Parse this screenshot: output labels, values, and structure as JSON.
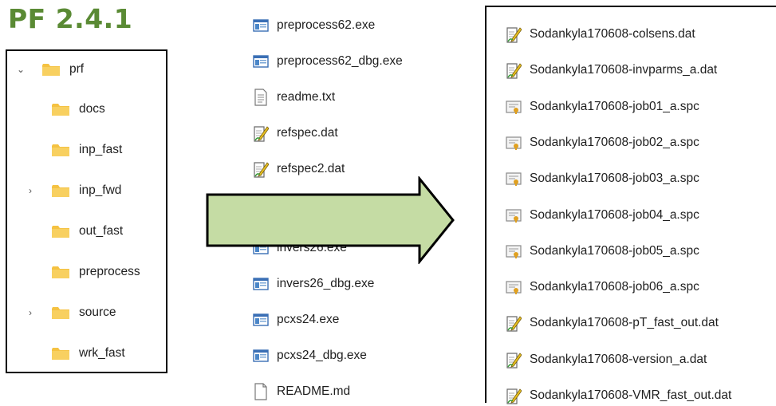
{
  "title": "PF 2.4.1",
  "tree": {
    "root": "prf",
    "items": [
      {
        "label": "docs",
        "expandable": false
      },
      {
        "label": "inp_fast",
        "expandable": false
      },
      {
        "label": "inp_fwd",
        "expandable": true
      },
      {
        "label": "out_fast",
        "expandable": false
      },
      {
        "label": "preprocess",
        "expandable": false
      },
      {
        "label": "source",
        "expandable": true
      },
      {
        "label": "wrk_fast",
        "expandable": false
      }
    ]
  },
  "middle_files": [
    {
      "name": "preprocess62.exe",
      "icon": "exe-icon"
    },
    {
      "name": "preprocess62_dbg.exe",
      "icon": "exe-icon"
    },
    {
      "name": "readme.txt",
      "icon": "text-file-icon"
    },
    {
      "name": "refspec.dat",
      "icon": "dat-file-icon"
    },
    {
      "name": "refspec2.dat",
      "icon": "dat-file-icon"
    },
    {
      "name": "invers26.exe",
      "icon": "exe-icon"
    },
    {
      "name": "invers26_dbg.exe",
      "icon": "exe-icon"
    },
    {
      "name": "pcxs24.exe",
      "icon": "exe-icon"
    },
    {
      "name": "pcxs24_dbg.exe",
      "icon": "exe-icon"
    },
    {
      "name": "README.md",
      "icon": "blank-file-icon"
    }
  ],
  "right_files": [
    {
      "name": "Sodankyla170608-colsens.dat",
      "icon": "dat-file-icon"
    },
    {
      "name": "Sodankyla170608-invparms_a.dat",
      "icon": "dat-file-icon"
    },
    {
      "name": "Sodankyla170608-job01_a.spc",
      "icon": "spc-file-icon"
    },
    {
      "name": "Sodankyla170608-job02_a.spc",
      "icon": "spc-file-icon"
    },
    {
      "name": "Sodankyla170608-job03_a.spc",
      "icon": "spc-file-icon"
    },
    {
      "name": "Sodankyla170608-job04_a.spc",
      "icon": "spc-file-icon"
    },
    {
      "name": "Sodankyla170608-job05_a.spc",
      "icon": "spc-file-icon"
    },
    {
      "name": "Sodankyla170608-job06_a.spc",
      "icon": "spc-file-icon"
    },
    {
      "name": "Sodankyla170608-pT_fast_out.dat",
      "icon": "dat-file-icon"
    },
    {
      "name": "Sodankyla170608-version_a.dat",
      "icon": "dat-file-icon"
    },
    {
      "name": "Sodankyla170608-VMR_fast_out.dat",
      "icon": "dat-file-icon"
    }
  ],
  "colors": {
    "title": "#5a8a34",
    "arrow_fill": "#c5dca4",
    "folder": "#f5c242"
  }
}
